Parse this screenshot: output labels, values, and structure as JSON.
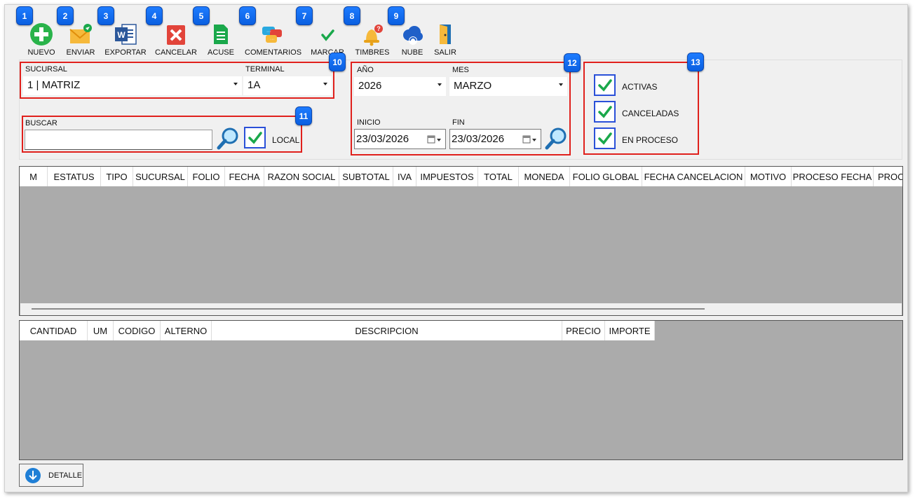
{
  "toolbar": {
    "items": [
      {
        "label": "NUEVO",
        "icon": "plus-circle-icon",
        "badge": "1"
      },
      {
        "label": "ENVIAR",
        "icon": "envelope-send-icon",
        "badge": "2"
      },
      {
        "label": "EXPORTAR",
        "icon": "word-document-icon",
        "badge": "3"
      },
      {
        "label": "CANCELAR",
        "icon": "cancel-x-icon",
        "badge": "4"
      },
      {
        "label": "ACUSE",
        "icon": "receipt-document-icon",
        "badge": "5"
      },
      {
        "label": "COMENTARIOS",
        "icon": "chat-bubbles-icon",
        "badge": "6"
      },
      {
        "label": "MARCAR",
        "icon": "checkmark-icon",
        "badge": "7"
      },
      {
        "label": "TIMBRES",
        "icon": "bell-alert-icon",
        "badge": "8"
      },
      {
        "label": "NUBE",
        "icon": "cloud-sync-icon",
        "badge": "9"
      },
      {
        "label": "SALIR",
        "icon": "exit-door-icon",
        "badge": ""
      }
    ]
  },
  "filters": {
    "sucursal_label": "SUCURSAL",
    "sucursal_value": "1 | MATRIZ",
    "terminal_label": "TERMINAL",
    "terminal_value": "1A",
    "badge_10": "10",
    "buscar_label": "BUSCAR",
    "buscar_value": "",
    "local_label": "LOCAL",
    "badge_11": "11"
  },
  "dates": {
    "anio_label": "AÑO",
    "anio_value": "2026",
    "mes_label": "MES",
    "mes_value": "MARZO",
    "inicio_label": "INICIO",
    "inicio_value": "23/03/2026",
    "fin_label": "FIN",
    "fin_value": "23/03/2026",
    "badge_12": "12"
  },
  "status_filters": {
    "badge_13": "13",
    "activas": "ACTIVAS",
    "canceladas": "CANCELADAS",
    "en_proceso": "EN PROCESO"
  },
  "main_grid": {
    "columns": [
      "M",
      "ESTATUS",
      "TIPO",
      "SUCURSAL",
      "FOLIO",
      "FECHA",
      "RAZON SOCIAL",
      "SUBTOTAL",
      "IVA",
      "IMPUESTOS",
      "TOTAL",
      "MONEDA",
      "FOLIO GLOBAL",
      "FECHA CANCELACION",
      "MOTIVO",
      "PROCESO FECHA",
      "PROCE"
    ]
  },
  "detail_grid": {
    "columns": [
      "CANTIDAD",
      "UM",
      "CODIGO",
      "ALTERNO",
      "DESCRIPCION",
      "PRECIO",
      "IMPORTE"
    ]
  },
  "footer": {
    "detalle_label": "DETALLE"
  },
  "colors": {
    "accent_blue": "#1e7cff",
    "highlight_red": "#e0201c",
    "grid_gray": "#ababab",
    "check_green": "#1aa84b"
  }
}
